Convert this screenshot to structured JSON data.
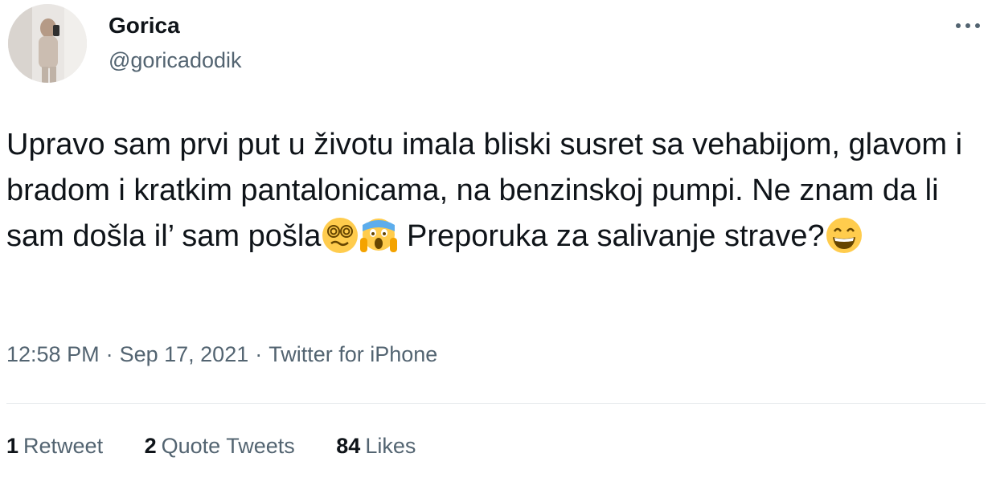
{
  "user": {
    "display_name": "Gorica",
    "handle": "@goricadodik"
  },
  "tweet": {
    "text_part1": "Upravo sam prvi put u životu imala  bliski susret sa vehabijom, glavom i bradom i kratkim pantalonicama, na benzinskoj pumpi. Ne znam da li sam došla il’ sam pošla",
    "text_part2": " Preporuka za salivanje strave?",
    "emojis": [
      "dizzy-face",
      "screaming-in-fear-face",
      "grinning-face-with-smiling-eyes"
    ]
  },
  "meta": {
    "time": "12:58 PM",
    "separator": "·",
    "date": "Sep 17, 2021",
    "source": "Twitter for iPhone"
  },
  "stats": {
    "retweets_count": "1",
    "retweets_label": "Retweet",
    "quotes_count": "2",
    "quotes_label": "Quote Tweets",
    "likes_count": "84",
    "likes_label": "Likes"
  },
  "colors": {
    "text": "#0f1419",
    "secondary": "#536471",
    "divider": "#e6e9ec",
    "emoji_yellow": "#ffcc4d"
  },
  "icons": {
    "more": "more-dots-icon"
  }
}
